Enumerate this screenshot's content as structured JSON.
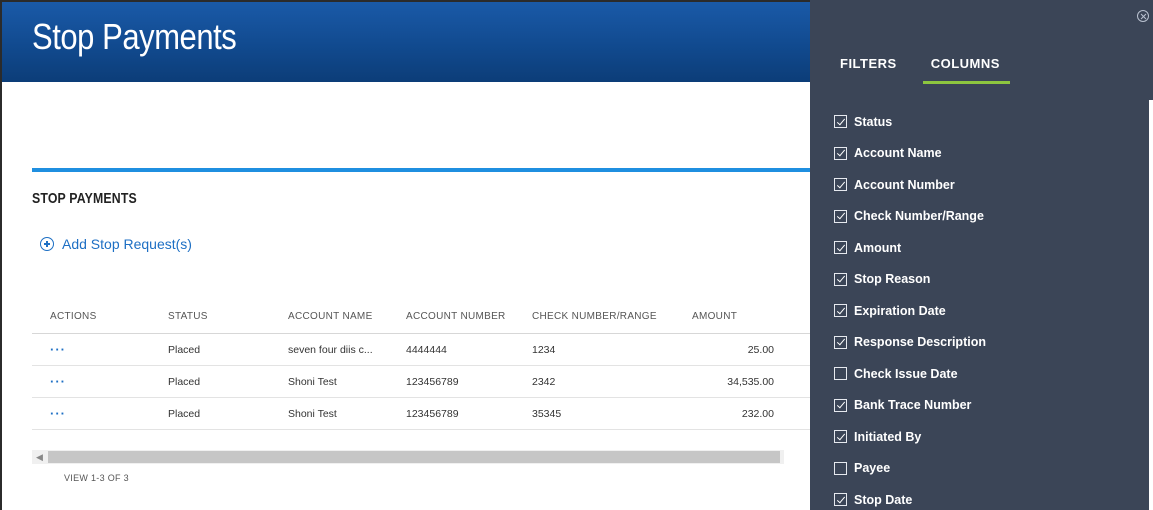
{
  "header": {
    "title": "Stop Payments"
  },
  "section": {
    "title": "STOP PAYMENTS",
    "add_link": "Add Stop Request(s)"
  },
  "table": {
    "columns": [
      "ACTIONS",
      "STATUS",
      "ACCOUNT NAME",
      "ACCOUNT NUMBER",
      "CHECK NUMBER/RANGE",
      "AMOUNT"
    ],
    "rows": [
      {
        "actions": "···",
        "status": "Placed",
        "account_name": "seven four diis c...",
        "account_number": "4444444",
        "check": "1234",
        "amount": "25.00"
      },
      {
        "actions": "···",
        "status": "Placed",
        "account_name": "Shoni Test",
        "account_number": "123456789",
        "check": "2342",
        "amount": "34,535.00"
      },
      {
        "actions": "···",
        "status": "Placed",
        "account_name": "Shoni Test",
        "account_number": "123456789",
        "check": "35345",
        "amount": "232.00"
      }
    ],
    "view_count": "VIEW 1-3 OF 3"
  },
  "panel": {
    "tabs": [
      {
        "label": "FILTERS",
        "active": false
      },
      {
        "label": "COLUMNS",
        "active": true
      }
    ],
    "columns": [
      {
        "label": "Status",
        "checked": true
      },
      {
        "label": "Account Name",
        "checked": true
      },
      {
        "label": "Account Number",
        "checked": true
      },
      {
        "label": "Check Number/Range",
        "checked": true
      },
      {
        "label": "Amount",
        "checked": true
      },
      {
        "label": "Stop Reason",
        "checked": true
      },
      {
        "label": "Expiration Date",
        "checked": true
      },
      {
        "label": "Response Description",
        "checked": true
      },
      {
        "label": "Check Issue Date",
        "checked": false
      },
      {
        "label": "Bank Trace Number",
        "checked": true
      },
      {
        "label": "Initiated By",
        "checked": true
      },
      {
        "label": "Payee",
        "checked": false
      },
      {
        "label": "Stop Date",
        "checked": true
      }
    ]
  },
  "colors": {
    "banner": "#114a8f",
    "accent_blue": "#1f8fe0",
    "link": "#1d6fc4",
    "panel_bg": "#3b4557",
    "tab_underline": "#8dc63f"
  }
}
